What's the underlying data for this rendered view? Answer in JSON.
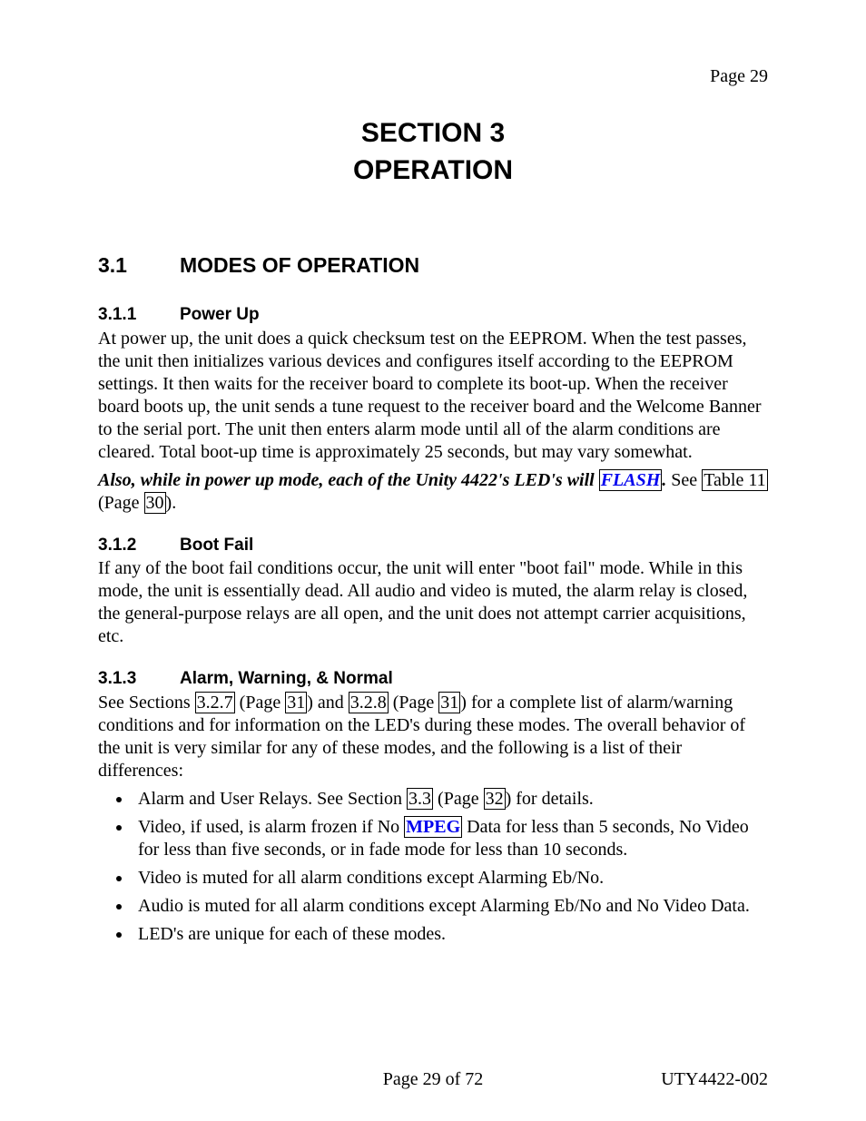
{
  "header": {
    "page_label": "Page 29"
  },
  "title": {
    "line1": "SECTION 3",
    "line2": "OPERATION"
  },
  "h1": {
    "num": "3.1",
    "text": "MODES OF OPERATION"
  },
  "s311": {
    "num": "3.1.1",
    "title": "Power Up",
    "p1": "At power up, the unit does a quick checksum test on the EEPROM.  When the test passes, the unit then initializes various devices and configures itself according to the EEPROM settings.  It then waits for the receiver board to complete its boot-up.  When the receiver board boots up, the unit sends a tune request to the receiver board and the Welcome Banner to the serial port.  The unit then enters alarm mode until all of the alarm conditions are cleared.  Total boot-up time is approximately 25 seconds, but may vary somewhat.",
    "p2_lead": " Also, while in power up mode, each of the Unity 4422's LED's will ",
    "p2_flash": "FLASH",
    "p2_after_flash": ".",
    "p2_see": "  See ",
    "p2_table_ref": "Table 11",
    "p2_openparen": " (Page ",
    "p2_pageref": "30",
    "p2_close": ")."
  },
  "s312": {
    "num": "3.1.2",
    "title": "Boot Fail",
    "p1": "If any of the boot fail conditions occur, the unit will enter \"boot fail\" mode.  While in this mode, the unit is essentially dead.  All audio and video is muted, the alarm relay is closed, the general-purpose relays are all open, and the unit does not attempt carrier acquisitions, etc."
  },
  "s313": {
    "num": "3.1.3",
    "title": "Alarm, Warning, & Normal",
    "p1_a": "See Sections ",
    "ref_327": "3.2.7",
    "p1_b": " (Page ",
    "ref_31a": "31",
    "p1_c": ") and ",
    "ref_328": "3.2.8",
    "p1_d": " (Page ",
    "ref_31b": "31",
    "p1_e": ") for a complete list of alarm/warning conditions and for information on the LED's during these modes.   The overall behavior of the unit is very similar for any of these modes, and the following is a list of their differences:",
    "bullets": {
      "b1_a": "Alarm and User Relays.   See Section ",
      "b1_ref33": "3.3",
      "b1_b": " (Page ",
      "b1_ref32": "32",
      "b1_c": ") for details.",
      "b2_a": "Video, if used, is alarm frozen if No ",
      "b2_mpeg": "MPEG",
      "b2_b": " Data for less than 5 seconds, No Video for less than five seconds, or in fade mode for less than 10 seconds.",
      "b3": "Video is muted for all alarm conditions except Alarming Eb/No.",
      "b4": "Audio is muted for all alarm conditions except Alarming Eb/No and No Video Data.",
      "b5": "LED's are unique for each of these modes."
    }
  },
  "footer": {
    "center": "Page 29 of 72",
    "right": "UTY4422-002"
  }
}
